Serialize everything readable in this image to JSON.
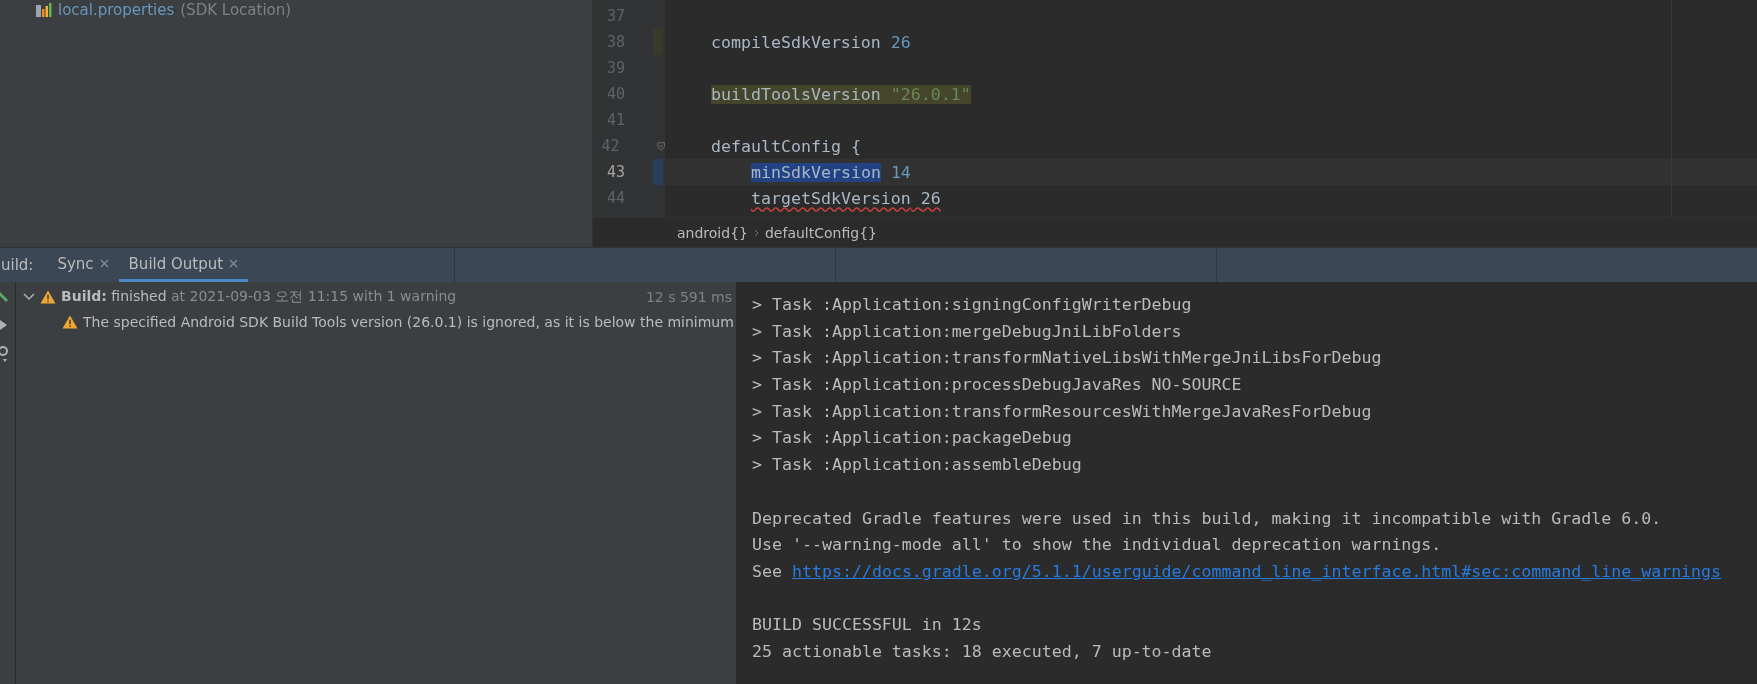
{
  "project_tree": {
    "items": [
      {
        "name": "local.properties",
        "note": "(SDK Location)"
      }
    ]
  },
  "editor": {
    "lines": [
      {
        "number": "37"
      },
      {
        "number": "38",
        "changed": true,
        "tokens": [
          {
            "text": "compileSdkVersion",
            "kind": "ident"
          },
          {
            "text": "26",
            "kind": "number"
          }
        ]
      },
      {
        "number": "39"
      },
      {
        "number": "40",
        "tokens": [
          {
            "text": "buildToolsVersion",
            "kind": "ident",
            "highlighted": true
          },
          {
            "text": "\"26.0.1\"",
            "kind": "string",
            "highlighted": true
          }
        ]
      },
      {
        "number": "41"
      },
      {
        "number": "42",
        "fold": true,
        "tokens": [
          {
            "text": "defaultConfig",
            "kind": "ident"
          },
          {
            "text": "{",
            "kind": "ident"
          }
        ],
        "children": [
          {
            "number": "43",
            "current": true,
            "changed": true,
            "tokens": [
              {
                "text": "minSdkVersion",
                "kind": "ident",
                "selected": true
              },
              {
                "text": "14",
                "kind": "number"
              }
            ]
          },
          {
            "number": "44",
            "tokens": [
              {
                "text": "targetSdkVersion",
                "kind": "ident",
                "squiggly": true
              },
              {
                "text": "26",
                "kind": "ident",
                "squiggly": true
              }
            ]
          }
        ]
      }
    ],
    "breadcrumbs": [
      "android{}",
      "defaultConfig{}"
    ]
  },
  "tool_window": {
    "label": "uild:",
    "tabs": [
      {
        "label": "Sync",
        "selected": false
      },
      {
        "label": "Build Output",
        "selected": true
      }
    ]
  },
  "build_tree": {
    "items": [
      {
        "warning": true,
        "title": "Build:",
        "text": "finished",
        "detail": "at 2021-09-03 오전 11:15 with 1 warning",
        "time": "12 s 591 ms",
        "expanded": true,
        "children": [
          {
            "warning": true,
            "text": "The specified Android SDK Build Tools version (26.0.1) is ignored, as it is below the minimum"
          }
        ]
      }
    ]
  },
  "console": {
    "lines": [
      {
        "kind": "text",
        "text": "> Task :Application:signingConfigWriterDebug"
      },
      {
        "kind": "text",
        "text": "> Task :Application:mergeDebugJniLibFolders"
      },
      {
        "kind": "text",
        "text": "> Task :Application:transformNativeLibsWithMergeJniLibsForDebug"
      },
      {
        "kind": "text",
        "text": "> Task :Application:processDebugJavaRes NO-SOURCE"
      },
      {
        "kind": "text",
        "text": "> Task :Application:transformResourcesWithMergeJavaResForDebug"
      },
      {
        "kind": "text",
        "text": "> Task :Application:packageDebug"
      },
      {
        "kind": "text",
        "text": "> Task :Application:assembleDebug"
      },
      {
        "kind": "blank"
      },
      {
        "kind": "text",
        "text": "Deprecated Gradle features were used in this build, making it incompatible with Gradle 6.0."
      },
      {
        "kind": "text",
        "text": "Use '--warning-mode all' to show the individual deprecation warnings."
      },
      {
        "kind": "link",
        "text": "See",
        "link": "https://docs.gradle.org/5.1.1/userguide/command_line_interface.html#sec:command_line_warnings"
      },
      {
        "kind": "blank"
      },
      {
        "kind": "text",
        "text": "BUILD SUCCESSFUL in 12s"
      },
      {
        "kind": "text",
        "text": "25 actionable tasks: 18 executed, 7 up-to-date"
      }
    ]
  }
}
